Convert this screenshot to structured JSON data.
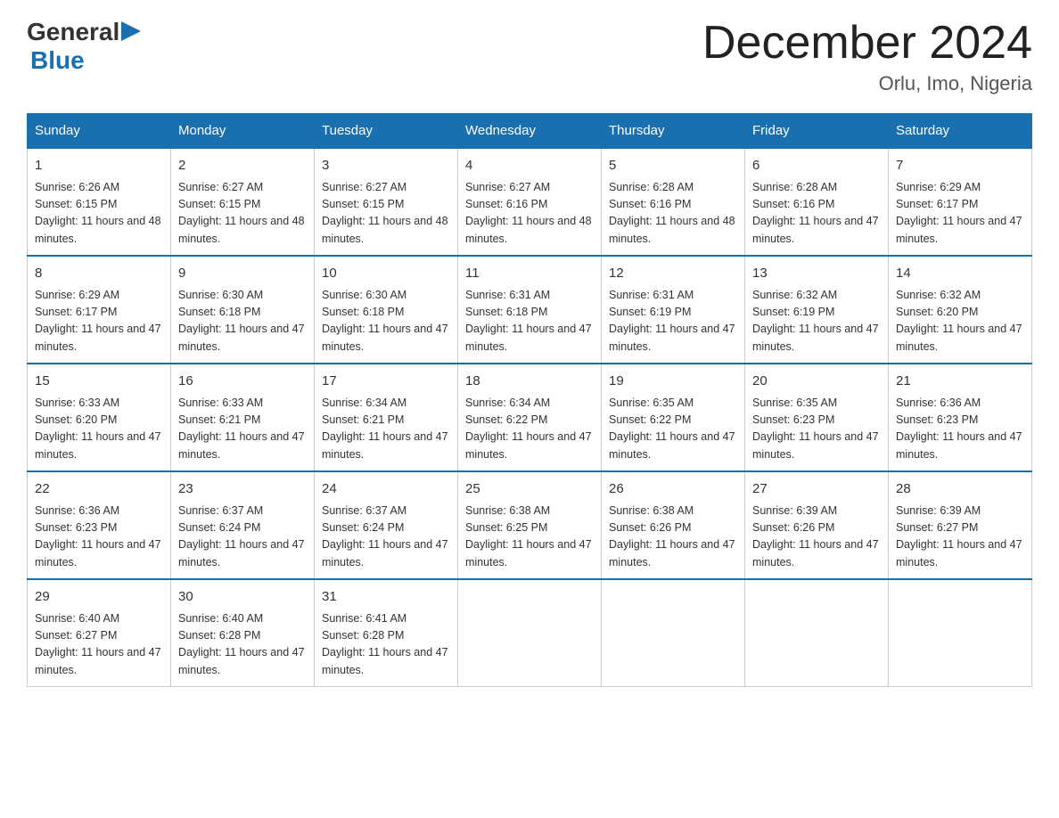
{
  "logo": {
    "line1": "General",
    "arrow": "▶",
    "line2": "Blue"
  },
  "title": "December 2024",
  "location": "Orlu, Imo, Nigeria",
  "days_of_week": [
    "Sunday",
    "Monday",
    "Tuesday",
    "Wednesday",
    "Thursday",
    "Friday",
    "Saturday"
  ],
  "weeks": [
    [
      {
        "day": "1",
        "sunrise": "6:26 AM",
        "sunset": "6:15 PM",
        "daylight": "11 hours and 48 minutes."
      },
      {
        "day": "2",
        "sunrise": "6:27 AM",
        "sunset": "6:15 PM",
        "daylight": "11 hours and 48 minutes."
      },
      {
        "day": "3",
        "sunrise": "6:27 AM",
        "sunset": "6:15 PM",
        "daylight": "11 hours and 48 minutes."
      },
      {
        "day": "4",
        "sunrise": "6:27 AM",
        "sunset": "6:16 PM",
        "daylight": "11 hours and 48 minutes."
      },
      {
        "day": "5",
        "sunrise": "6:28 AM",
        "sunset": "6:16 PM",
        "daylight": "11 hours and 48 minutes."
      },
      {
        "day": "6",
        "sunrise": "6:28 AM",
        "sunset": "6:16 PM",
        "daylight": "11 hours and 47 minutes."
      },
      {
        "day": "7",
        "sunrise": "6:29 AM",
        "sunset": "6:17 PM",
        "daylight": "11 hours and 47 minutes."
      }
    ],
    [
      {
        "day": "8",
        "sunrise": "6:29 AM",
        "sunset": "6:17 PM",
        "daylight": "11 hours and 47 minutes."
      },
      {
        "day": "9",
        "sunrise": "6:30 AM",
        "sunset": "6:18 PM",
        "daylight": "11 hours and 47 minutes."
      },
      {
        "day": "10",
        "sunrise": "6:30 AM",
        "sunset": "6:18 PM",
        "daylight": "11 hours and 47 minutes."
      },
      {
        "day": "11",
        "sunrise": "6:31 AM",
        "sunset": "6:18 PM",
        "daylight": "11 hours and 47 minutes."
      },
      {
        "day": "12",
        "sunrise": "6:31 AM",
        "sunset": "6:19 PM",
        "daylight": "11 hours and 47 minutes."
      },
      {
        "day": "13",
        "sunrise": "6:32 AM",
        "sunset": "6:19 PM",
        "daylight": "11 hours and 47 minutes."
      },
      {
        "day": "14",
        "sunrise": "6:32 AM",
        "sunset": "6:20 PM",
        "daylight": "11 hours and 47 minutes."
      }
    ],
    [
      {
        "day": "15",
        "sunrise": "6:33 AM",
        "sunset": "6:20 PM",
        "daylight": "11 hours and 47 minutes."
      },
      {
        "day": "16",
        "sunrise": "6:33 AM",
        "sunset": "6:21 PM",
        "daylight": "11 hours and 47 minutes."
      },
      {
        "day": "17",
        "sunrise": "6:34 AM",
        "sunset": "6:21 PM",
        "daylight": "11 hours and 47 minutes."
      },
      {
        "day": "18",
        "sunrise": "6:34 AM",
        "sunset": "6:22 PM",
        "daylight": "11 hours and 47 minutes."
      },
      {
        "day": "19",
        "sunrise": "6:35 AM",
        "sunset": "6:22 PM",
        "daylight": "11 hours and 47 minutes."
      },
      {
        "day": "20",
        "sunrise": "6:35 AM",
        "sunset": "6:23 PM",
        "daylight": "11 hours and 47 minutes."
      },
      {
        "day": "21",
        "sunrise": "6:36 AM",
        "sunset": "6:23 PM",
        "daylight": "11 hours and 47 minutes."
      }
    ],
    [
      {
        "day": "22",
        "sunrise": "6:36 AM",
        "sunset": "6:23 PM",
        "daylight": "11 hours and 47 minutes."
      },
      {
        "day": "23",
        "sunrise": "6:37 AM",
        "sunset": "6:24 PM",
        "daylight": "11 hours and 47 minutes."
      },
      {
        "day": "24",
        "sunrise": "6:37 AM",
        "sunset": "6:24 PM",
        "daylight": "11 hours and 47 minutes."
      },
      {
        "day": "25",
        "sunrise": "6:38 AM",
        "sunset": "6:25 PM",
        "daylight": "11 hours and 47 minutes."
      },
      {
        "day": "26",
        "sunrise": "6:38 AM",
        "sunset": "6:26 PM",
        "daylight": "11 hours and 47 minutes."
      },
      {
        "day": "27",
        "sunrise": "6:39 AM",
        "sunset": "6:26 PM",
        "daylight": "11 hours and 47 minutes."
      },
      {
        "day": "28",
        "sunrise": "6:39 AM",
        "sunset": "6:27 PM",
        "daylight": "11 hours and 47 minutes."
      }
    ],
    [
      {
        "day": "29",
        "sunrise": "6:40 AM",
        "sunset": "6:27 PM",
        "daylight": "11 hours and 47 minutes."
      },
      {
        "day": "30",
        "sunrise": "6:40 AM",
        "sunset": "6:28 PM",
        "daylight": "11 hours and 47 minutes."
      },
      {
        "day": "31",
        "sunrise": "6:41 AM",
        "sunset": "6:28 PM",
        "daylight": "11 hours and 47 minutes."
      },
      null,
      null,
      null,
      null
    ]
  ]
}
